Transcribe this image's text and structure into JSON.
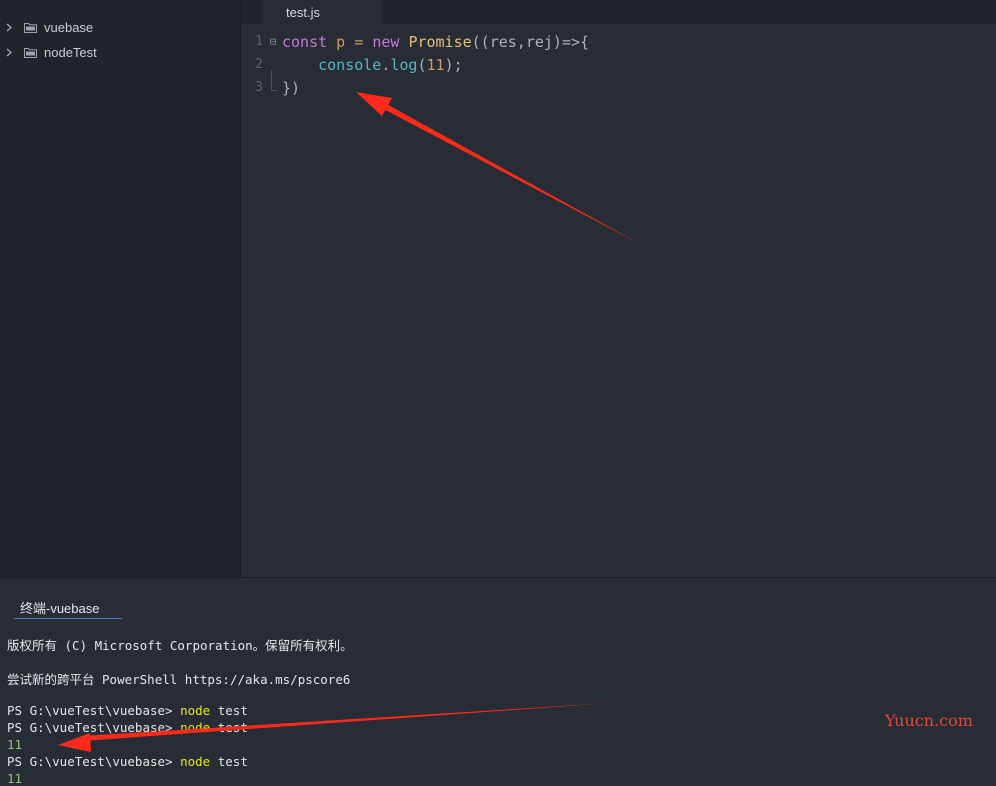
{
  "sidebar": {
    "items": [
      {
        "label": "vuebase",
        "icon": "folder-icon"
      },
      {
        "label": "nodeTest",
        "icon": "folder-icon"
      }
    ]
  },
  "editor": {
    "tab_label": "test.js",
    "line_numbers": [
      "1",
      "2",
      "3"
    ],
    "lines": [
      {
        "tokens": [
          "const",
          " p = ",
          "new",
          " ",
          "Promise",
          "((res,rej)=>{"
        ]
      },
      {
        "tokens": [
          "    ",
          "console",
          ".",
          "log",
          "(",
          "11",
          ");"
        ]
      },
      {
        "tokens": [
          "})"
        ]
      }
    ]
  },
  "terminal": {
    "tab_label": "终端-vuebase",
    "lines": [
      "版权所有 (C) Microsoft Corporation。保留所有权利。",
      "尝试新的跨平台 PowerShell https://aka.ms/pscore6",
      "PS G:\\vueTest\\vuebase>",
      "node",
      "test",
      "11"
    ]
  },
  "watermark": "Yuucn.com",
  "colors": {
    "background": "#282c34",
    "sidebar": "#21252b",
    "keyword": "#c678dd",
    "class": "#e5c07b",
    "function": "#56b6c2",
    "number": "#d19a66",
    "command": "#e5e510",
    "output": "#98c379",
    "annotation_arrow": "#ff2a1a"
  }
}
